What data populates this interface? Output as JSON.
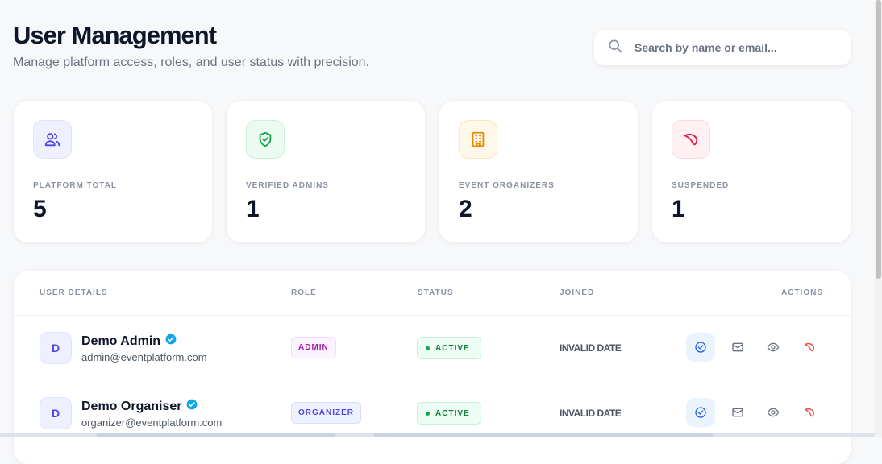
{
  "header": {
    "title": "User Management",
    "subtitle": "Manage platform access, roles, and user status with precision."
  },
  "search": {
    "placeholder": "Search by name or email...",
    "icon": "search-icon"
  },
  "stats": [
    {
      "label": "PLATFORM TOTAL",
      "value": "5",
      "icon": "users-icon",
      "color": "#4f46e5"
    },
    {
      "label": "VERIFIED ADMINS",
      "value": "1",
      "icon": "shield-check-icon",
      "color": "#16a34a"
    },
    {
      "label": "EVENT ORGANIZERS",
      "value": "2",
      "icon": "building-icon",
      "color": "#ea8a0c"
    },
    {
      "label": "SUSPENDED",
      "value": "1",
      "icon": "ban-icon",
      "color": "#e11d48"
    }
  ],
  "table": {
    "columns": [
      "USER DETAILS",
      "ROLE",
      "STATUS",
      "JOINED",
      "ACTIONS"
    ],
    "rows": [
      {
        "initial": "D",
        "name": "Demo Admin",
        "email": "admin@eventplatform.com",
        "role": "ADMIN",
        "status": "ACTIVE",
        "joined": "INVALID DATE"
      },
      {
        "initial": "D",
        "name": "Demo Organiser",
        "email": "organizer@eventplatform.com",
        "role": "ORGANIZER",
        "status": "ACTIVE",
        "joined": "INVALID DATE"
      }
    ],
    "actions": [
      "verify-icon",
      "mail-icon",
      "eye-icon",
      "suspend-icon"
    ]
  }
}
